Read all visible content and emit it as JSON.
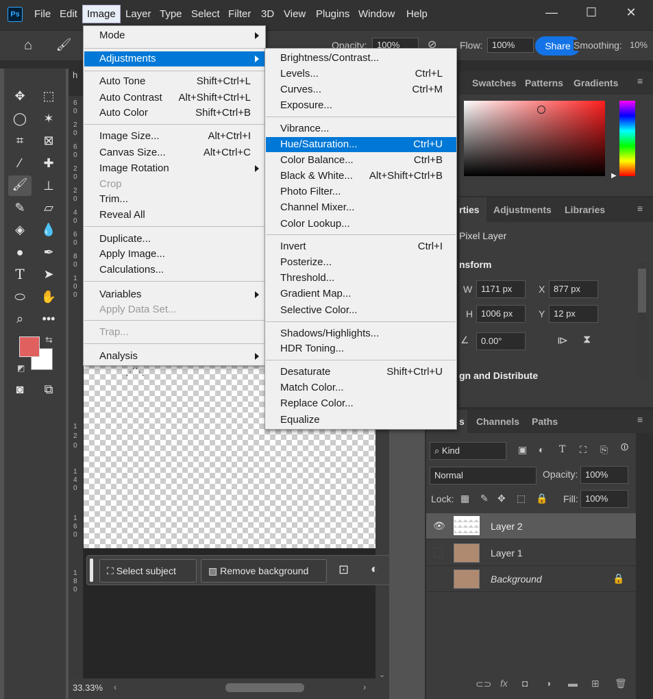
{
  "menubar": {
    "logo": "Ps",
    "items": [
      "File",
      "Edit",
      "Image",
      "Layer",
      "Type",
      "Select",
      "Filter",
      "3D",
      "View",
      "Plugins",
      "Window",
      "Help"
    ]
  },
  "options": {
    "opacity_label": "Opacity:",
    "opacity_value": "100%",
    "flow_label": "Flow:",
    "flow_value": "100%",
    "share_label": "Share",
    "smoothing_label": "Smoothing:",
    "smoothing_value": "10%"
  },
  "image_menu": {
    "items": [
      {
        "label": "Mode",
        "shortcut": "",
        "submenu": true
      },
      {
        "label": "Adjustments",
        "shortcut": "",
        "submenu": true,
        "highlighted": true
      },
      {
        "label": "Auto Tone",
        "shortcut": "Shift+Ctrl+L"
      },
      {
        "label": "Auto Contrast",
        "shortcut": "Alt+Shift+Ctrl+L"
      },
      {
        "label": "Auto Color",
        "shortcut": "Shift+Ctrl+B"
      },
      {
        "label": "Image Size...",
        "shortcut": "Alt+Ctrl+I"
      },
      {
        "label": "Canvas Size...",
        "shortcut": "Alt+Ctrl+C"
      },
      {
        "label": "Image Rotation",
        "shortcut": "",
        "submenu": true
      },
      {
        "label": "Crop",
        "shortcut": "",
        "disabled": true
      },
      {
        "label": "Trim...",
        "shortcut": ""
      },
      {
        "label": "Reveal All",
        "shortcut": ""
      },
      {
        "label": "Duplicate...",
        "shortcut": ""
      },
      {
        "label": "Apply Image...",
        "shortcut": ""
      },
      {
        "label": "Calculations...",
        "shortcut": ""
      },
      {
        "label": "Variables",
        "shortcut": "",
        "submenu": true
      },
      {
        "label": "Apply Data Set...",
        "shortcut": "",
        "disabled": true
      },
      {
        "label": "Trap...",
        "shortcut": "",
        "disabled": true
      },
      {
        "label": "Analysis",
        "shortcut": "",
        "submenu": true
      }
    ]
  },
  "adjust_menu": {
    "items": [
      {
        "label": "Brightness/Contrast...",
        "shortcut": ""
      },
      {
        "label": "Levels...",
        "shortcut": "Ctrl+L"
      },
      {
        "label": "Curves...",
        "shortcut": "Ctrl+M"
      },
      {
        "label": "Exposure...",
        "shortcut": ""
      },
      {
        "label": "Vibrance...",
        "shortcut": ""
      },
      {
        "label": "Hue/Saturation...",
        "shortcut": "Ctrl+U",
        "highlighted": true
      },
      {
        "label": "Color Balance...",
        "shortcut": "Ctrl+B"
      },
      {
        "label": "Black & White...",
        "shortcut": "Alt+Shift+Ctrl+B"
      },
      {
        "label": "Photo Filter...",
        "shortcut": ""
      },
      {
        "label": "Channel Mixer...",
        "shortcut": ""
      },
      {
        "label": "Color Lookup...",
        "shortcut": ""
      },
      {
        "label": "Invert",
        "shortcut": "Ctrl+I"
      },
      {
        "label": "Posterize...",
        "shortcut": ""
      },
      {
        "label": "Threshold...",
        "shortcut": ""
      },
      {
        "label": "Gradient Map...",
        "shortcut": ""
      },
      {
        "label": "Selective Color...",
        "shortcut": ""
      },
      {
        "label": "Shadows/Highlights...",
        "shortcut": ""
      },
      {
        "label": "HDR Toning...",
        "shortcut": ""
      },
      {
        "label": "Desaturate",
        "shortcut": "Shift+Ctrl+U"
      },
      {
        "label": "Match Color...",
        "shortcut": ""
      },
      {
        "label": "Replace Color...",
        "shortcut": ""
      },
      {
        "label": "Equalize",
        "shortcut": ""
      }
    ]
  },
  "color_panel": {
    "tabs": [
      "Swatches",
      "Patterns",
      "Gradients"
    ]
  },
  "properties": {
    "tabs": [
      "rties",
      "Adjustments",
      "Libraries"
    ],
    "layer_type": "Pixel Layer",
    "transform_title": "nsform",
    "w_label": "W",
    "w_value": "1171 px",
    "x_label": "X",
    "x_value": "877 px",
    "h_label": "H",
    "h_value": "1006 px",
    "y_label": "Y",
    "y_value": "12 px",
    "angle_value": "0.00°",
    "align_title": "gn and Distribute"
  },
  "layers_panel": {
    "tabs": [
      "s",
      "Channels",
      "Paths"
    ],
    "filter_kind": "Kind",
    "blend_mode": "Normal",
    "opacity_label": "Opacity:",
    "opacity_value": "100%",
    "lock_label": "Lock:",
    "fill_label": "Fill:",
    "fill_value": "100%",
    "layers": [
      {
        "name": "Layer 2",
        "selected": true,
        "visible": true
      },
      {
        "name": "Layer 1",
        "selected": false,
        "visible": false
      },
      {
        "name": "Background",
        "selected": false,
        "visible": false,
        "locked": true
      }
    ]
  },
  "taskbar": {
    "select_subject": "Select subject",
    "remove_background": "Remove background"
  },
  "status": {
    "zoom": "33.33%"
  },
  "ruler": {
    "numbers": [
      "6",
      "0",
      "2",
      "0",
      "6",
      "0",
      "2",
      "0",
      "2",
      "0",
      "4",
      "0",
      "6",
      "0",
      "8",
      "0",
      "1",
      "0",
      "0",
      "1",
      "2",
      "0",
      "1",
      "4",
      "0",
      "1",
      "6",
      "0",
      "1",
      "8",
      "0"
    ]
  },
  "colors": {
    "foreground": "#e06060",
    "background": "#ffffff",
    "accent": "#0078d7",
    "share": "#1473e6"
  }
}
